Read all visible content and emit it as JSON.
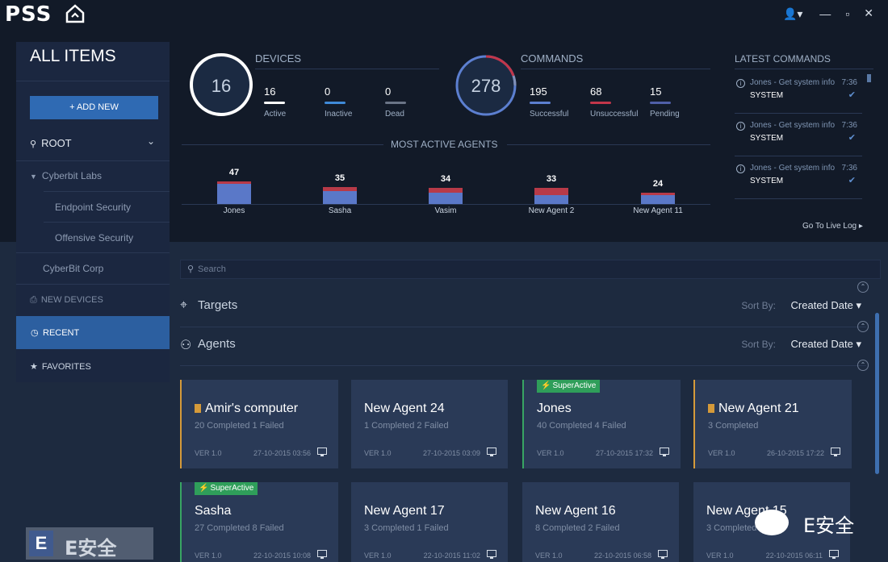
{
  "app": {
    "logo": "PSS",
    "window_controls": [
      "—",
      "▫",
      "✕"
    ],
    "user_menu": "👤▾"
  },
  "sidebar": {
    "title": "ALL ITEMS",
    "add_new": "+ ADD NEW",
    "root": "ROOT",
    "cyberbit_labs": "Cyberbit Labs",
    "endpoint_security": "Endpoint Security",
    "offensive_security": "Offensive Security",
    "cyberbit_corp": "CyberBit Corp",
    "new_devices": "NEW DEVICES",
    "recent": "RECENT",
    "favorites": "FAVORITES"
  },
  "devices": {
    "title": "DEVICES",
    "total": "16",
    "active": "16",
    "active_label": "Active",
    "inactive": "0",
    "inactive_label": "Inactive",
    "dead": "0",
    "dead_label": "Dead"
  },
  "commands": {
    "title": "COMMANDS",
    "total": "278",
    "successful": "195",
    "successful_label": "Successful",
    "unsuccessful": "68",
    "unsuccessful_label": "Unsuccessful",
    "pending": "15",
    "pending_label": "Pending"
  },
  "colors": {
    "active": "#ffffff",
    "inactive": "#3f8ad8",
    "dead": "#6a7486",
    "successful": "#5c7fd0",
    "unsuccessful": "#c2364a",
    "pending": "#4f5fa8",
    "bar_blue": "#5a78c8",
    "bar_red": "#b83a48"
  },
  "chart_data": {
    "type": "bar",
    "title": "MOST ACTIVE AGENTS",
    "categories": [
      "Jones",
      "Sasha",
      "Vasim",
      "New Agent 2",
      "New Agent 11"
    ],
    "values": [
      47,
      35,
      34,
      33,
      24
    ],
    "segments": [
      {
        "blue": 42,
        "red": 5
      },
      {
        "blue": 27,
        "red": 8
      },
      {
        "blue": 23,
        "red": 11
      },
      {
        "blue": 18,
        "red": 15
      },
      {
        "blue": 18,
        "red": 6
      }
    ]
  },
  "latest_commands": {
    "title": "LATEST COMMANDS",
    "items": [
      {
        "text": "Jones - Get system info",
        "time": "7:36",
        "status": "SYSTEM"
      },
      {
        "text": "Jones - Get system info",
        "time": "7:36",
        "status": "SYSTEM"
      },
      {
        "text": "Jones - Get system info",
        "time": "7:36",
        "status": "SYSTEM"
      }
    ],
    "live_log": "Go To Live Log ▸"
  },
  "search": {
    "placeholder": "Search"
  },
  "targets": {
    "label": "Targets",
    "sort_label": "Sort By:",
    "sort_value": "Created Date ▾"
  },
  "agents": {
    "label": "Agents",
    "sort_label": "Sort By:",
    "sort_value": "Created Date ▾"
  },
  "cards": [
    {
      "title": "Amir's computer",
      "sub": "20 Completed 1 Failed",
      "ver": "VER 1.0",
      "date": "27-10-2015 03:56",
      "accent": "orange",
      "bookmark": true,
      "badge": ""
    },
    {
      "title": "New Agent 24",
      "sub": "1 Completed 2 Failed",
      "ver": "VER 1.0",
      "date": "27-10-2015 03:09",
      "accent": "",
      "bookmark": false,
      "badge": ""
    },
    {
      "title": "Jones",
      "sub": "40 Completed 4 Failed",
      "ver": "VER 1.0",
      "date": "27-10-2015 17:32",
      "accent": "green",
      "bookmark": false,
      "badge": "SuperActive"
    },
    {
      "title": "New Agent 21",
      "sub": "3 Completed",
      "ver": "VER 1.0",
      "date": "26-10-2015 17:22",
      "accent": "orange",
      "bookmark": true,
      "badge": ""
    },
    {
      "title": "Sasha",
      "sub": "27 Completed 8 Failed",
      "ver": "VER 1.0",
      "date": "22-10-2015 10:08",
      "accent": "green",
      "bookmark": false,
      "badge": "SuperActive"
    },
    {
      "title": "New Agent 17",
      "sub": "3 Completed 1 Failed",
      "ver": "VER 1.0",
      "date": "22-10-2015 11:02",
      "accent": "",
      "bookmark": false,
      "badge": ""
    },
    {
      "title": "New Agent 16",
      "sub": "8 Completed 2 Failed",
      "ver": "VER 1.0",
      "date": "22-10-2015 06:58",
      "accent": "",
      "bookmark": false,
      "badge": ""
    },
    {
      "title": "New Agent 15",
      "sub": "3 Completed",
      "ver": "VER 1.0",
      "date": "22-10-2015 06:11",
      "accent": "",
      "bookmark": false,
      "badge": ""
    }
  ],
  "watermarks": {
    "left": "E安全",
    "right": "E安全"
  }
}
